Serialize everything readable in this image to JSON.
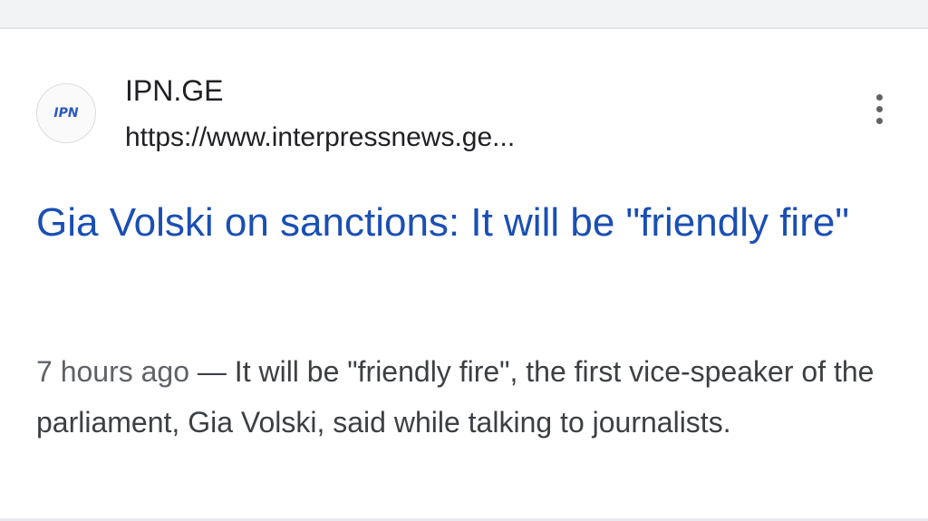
{
  "result": {
    "favicon": {
      "text": "IPN",
      "icon": "ipn-logo-icon",
      "accent_color": "#2b59c3"
    },
    "site_name": "IPN.GE",
    "site_url": "https://www.interpressnews.ge...",
    "more_menu_icon": "vertical-dots-icon",
    "headline": "Gia Volski on sanctions: It will be \"friendly fire\"",
    "snippet": {
      "date": "7 hours ago",
      "separator": " — ",
      "text": "It will be \"friendly fire\", the first vice-speaker of the parliament, Gia Volski, said while talking to journalists."
    }
  },
  "colors": {
    "headline_link": "#1a4fb4",
    "body_text": "#3c4043",
    "page_background": "#ffffff"
  }
}
